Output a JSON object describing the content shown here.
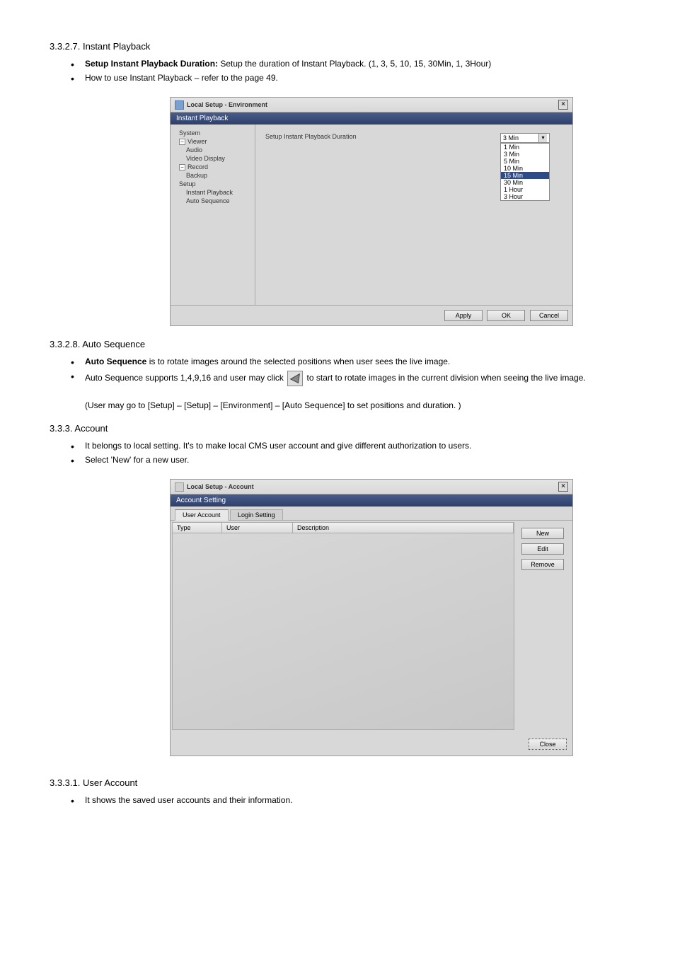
{
  "sec_playback": {
    "heading": "3.3.2.7. Instant Playback",
    "bullets": [
      {
        "b": "Setup Instant Playback Duration:",
        "t": " Setup the duration of Instant Playback. (1, 3, 5, 10, 15, 30Min, 1, 3Hour)"
      },
      {
        "b": "",
        "t": "How to use Instant Playback – refer to the page 49."
      }
    ]
  },
  "env_dialog": {
    "title": "Local Setup - Environment",
    "panel": "Instant Playback",
    "tree": {
      "system": "System",
      "viewer": "Viewer",
      "audio": "Audio",
      "video": "Video Display",
      "record": "Record",
      "backup": "Backup",
      "setup": "Setup",
      "instant": "Instant Playback",
      "auto": "Auto Sequence"
    },
    "field_label": "Setup Instant Playback Duration",
    "selected": "3 Min",
    "options": [
      "1 Min",
      "3 Min",
      "5 Min",
      "10 Min",
      "15 Min",
      "30 Min",
      "1 Hour",
      "3 Hour"
    ],
    "highlight_index": 4,
    "btn_apply": "Apply",
    "btn_ok": "OK",
    "btn_cancel": "Cancel"
  },
  "sec_autoseq": {
    "heading": "3.3.2.8. Auto Sequence",
    "bullet1": {
      "b": "Auto Sequence",
      "t": " is to rotate images around the selected positions when user sees the live image."
    },
    "bullet2_pre": "Auto Sequence supports 1,4,9,16 and user may click ",
    "bullet2_post": " to start to rotate images in the current division when seeing the live image.",
    "small_note": "(User may go to [Setup] – [Setup] – [Environment] – [Auto Sequence] to set positions and duration. )"
  },
  "sec_account": {
    "heading": "3.3.3. Account",
    "bullets": [
      "It belongs to local setting. It's to make local CMS user account and give different authorization to users.",
      "Select 'New' for a new user."
    ]
  },
  "acct_dialog": {
    "title": "Local Setup - Account",
    "panel": "Account Setting",
    "tab1": "User Account",
    "tab2": "Login Setting",
    "col_type": "Type",
    "col_user": "User",
    "col_desc": "Description",
    "btn_new": "New",
    "btn_edit": "Edit",
    "btn_remove": "Remove",
    "btn_close": "Close"
  },
  "sec_3331": {
    "heading": "3.3.3.1. User Account",
    "bullet": "It shows the saved user accounts and their information."
  }
}
